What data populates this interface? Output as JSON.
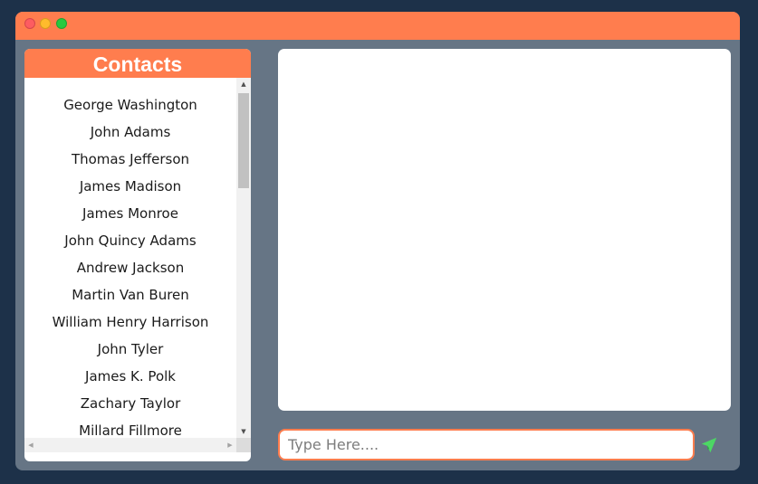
{
  "window": {
    "controls": [
      "close",
      "minimize",
      "maximize"
    ]
  },
  "contacts": {
    "title": "Contacts",
    "items": [
      "George Washington",
      "John Adams",
      "Thomas Jefferson",
      "James Madison",
      "James Monroe",
      "John Quincy Adams",
      "Andrew Jackson",
      "Martin Van Buren",
      "William Henry Harrison",
      "John Tyler",
      "James K. Polk",
      "Zachary Taylor",
      "Millard Fillmore"
    ]
  },
  "composer": {
    "value": "",
    "placeholder": "Type Here...."
  },
  "icons": {
    "send": "paper-plane-send-icon"
  },
  "colors": {
    "accent": "#ff7d4e",
    "window_bg": "#667585",
    "page_bg": "#1d3149",
    "send_icon": "#4cd964"
  }
}
